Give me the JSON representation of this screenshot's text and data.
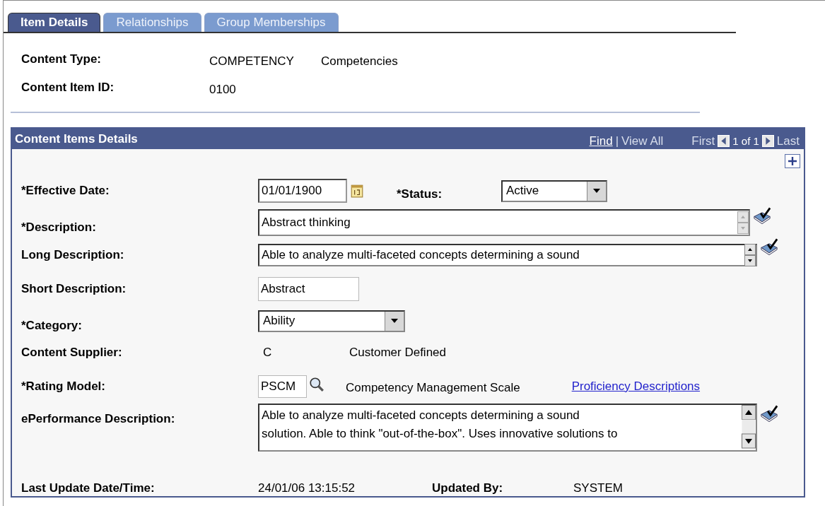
{
  "tabs": [
    {
      "label": "Item Details",
      "selected": true
    },
    {
      "label": "Relationships",
      "selected": false
    },
    {
      "label": "Group Memberships",
      "selected": false
    }
  ],
  "header_fields": [
    {
      "label": "Content Type:",
      "values": [
        "COMPETENCY",
        "Competencies"
      ]
    },
    {
      "label": "Content Item ID:",
      "values": [
        "0100"
      ]
    }
  ],
  "panel": {
    "title": "Content Items Details",
    "find": "Find",
    "separator": "|",
    "view_all": "View All",
    "first": "First",
    "count": "1 of 1",
    "last": "Last",
    "effective_date": {
      "label": "*Effective Date:",
      "value": "01/01/1900"
    },
    "status": {
      "label": "*Status:",
      "value": "Active"
    },
    "description": {
      "label": "*Description:",
      "value": "Abstract thinking"
    },
    "long_description": {
      "label": "Long Description:",
      "value": "Able to analyze multi-faceted concepts determining a sound"
    },
    "short_description": {
      "label": "Short Description:",
      "value": "Abstract"
    },
    "category": {
      "label": "*Category:",
      "value": "Ability"
    },
    "content_supplier": {
      "label": "Content Supplier:",
      "code": "C",
      "name": "Customer Defined"
    },
    "rating_model": {
      "label": "*Rating Model:",
      "value": "PSCM",
      "name": "Competency Management Scale",
      "link": "Proficiency Descriptions"
    },
    "eperformance_description": {
      "label": "ePerformance Description:",
      "lines": [
        "Able to analyze multi-faceted concepts determining a sound",
        "solution.  Able to think \"out-of-the-box\".  Uses innovative solutions to"
      ]
    },
    "last_update": {
      "label": "Last Update Date/Time:",
      "value": "24/01/06 13:15:52"
    },
    "updated_by": {
      "label": "Updated By:",
      "value": "SYSTEM"
    }
  }
}
